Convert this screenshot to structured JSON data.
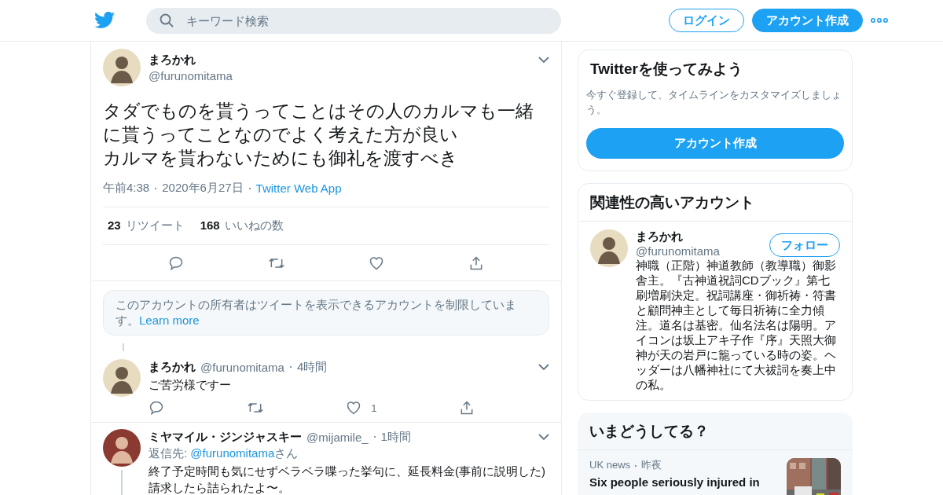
{
  "header": {
    "search_placeholder": "キーワード検索",
    "login": "ログイン",
    "signup": "アカウント作成"
  },
  "tweet": {
    "name": "まろかれ",
    "handle": "@furunomitama",
    "lines": [
      "タダでものを貰うってことはその人のカルマも一緒に貰うってことなのでよく考えた方が良い",
      "カルマを貰わないためにも御礼を渡すべき"
    ],
    "time": "午前4:38",
    "date": "2020年6月27日",
    "source": "Twitter Web App",
    "retweets": "23",
    "retweets_label": "リツイート",
    "likes": "168",
    "likes_label": "いいねの数"
  },
  "notice": {
    "text": "このアカウントの所有者はツイートを表示できるアカウントを制限しています。",
    "link": "Learn more"
  },
  "replies": [
    {
      "name": "まろかれ",
      "handle": "@furunomitama",
      "time": "4時間",
      "lines": [
        "ご苦労様ですー"
      ],
      "like_count": "1"
    },
    {
      "name": "ミヤマイル・ジンジャスキー",
      "handle": "@mijamile_",
      "time": "1時間",
      "reply_label": "返信先:",
      "reply_to": "@furunomitama",
      "reply_suffix": "さん",
      "lines": [
        "終了予定時間も気にせずベラベラ喋った挙句に、延長料金(事前に説明した)請求したら詰られたよ〜。"
      ]
    }
  ],
  "sidebar": {
    "signup_card": {
      "title": "Twitterを使ってみよう",
      "text": "今すぐ登録して、タイムラインをカスタマイズしましょう。",
      "button": "アカウント作成"
    },
    "related": {
      "title": "関連性の高いアカウント",
      "account": {
        "name": "まろかれ",
        "handle": "@furunomitama",
        "button": "フォロー",
        "bio": "神職（正階）神道教師（教導職）御影舎主。『古神道祝詞CDブック』第七刷増刷決定。祝詞講座・御祈祷・符書と顧問神主として毎日祈祷に全力傾注。道名は基密。仙名法名は陽明。アイコンは坂上アキ子作『序』天照大御神が天の岩戸に籠っている時の姿。ヘッダーは八幡神社にて大祓詞を奏上中の私。"
      }
    },
    "trends": {
      "title": "いまどうしてる？",
      "items": [
        {
          "source": "UK news",
          "time": "昨夜",
          "headline": "Six people seriously injured in",
          "kind": "picture"
        }
      ]
    }
  }
}
